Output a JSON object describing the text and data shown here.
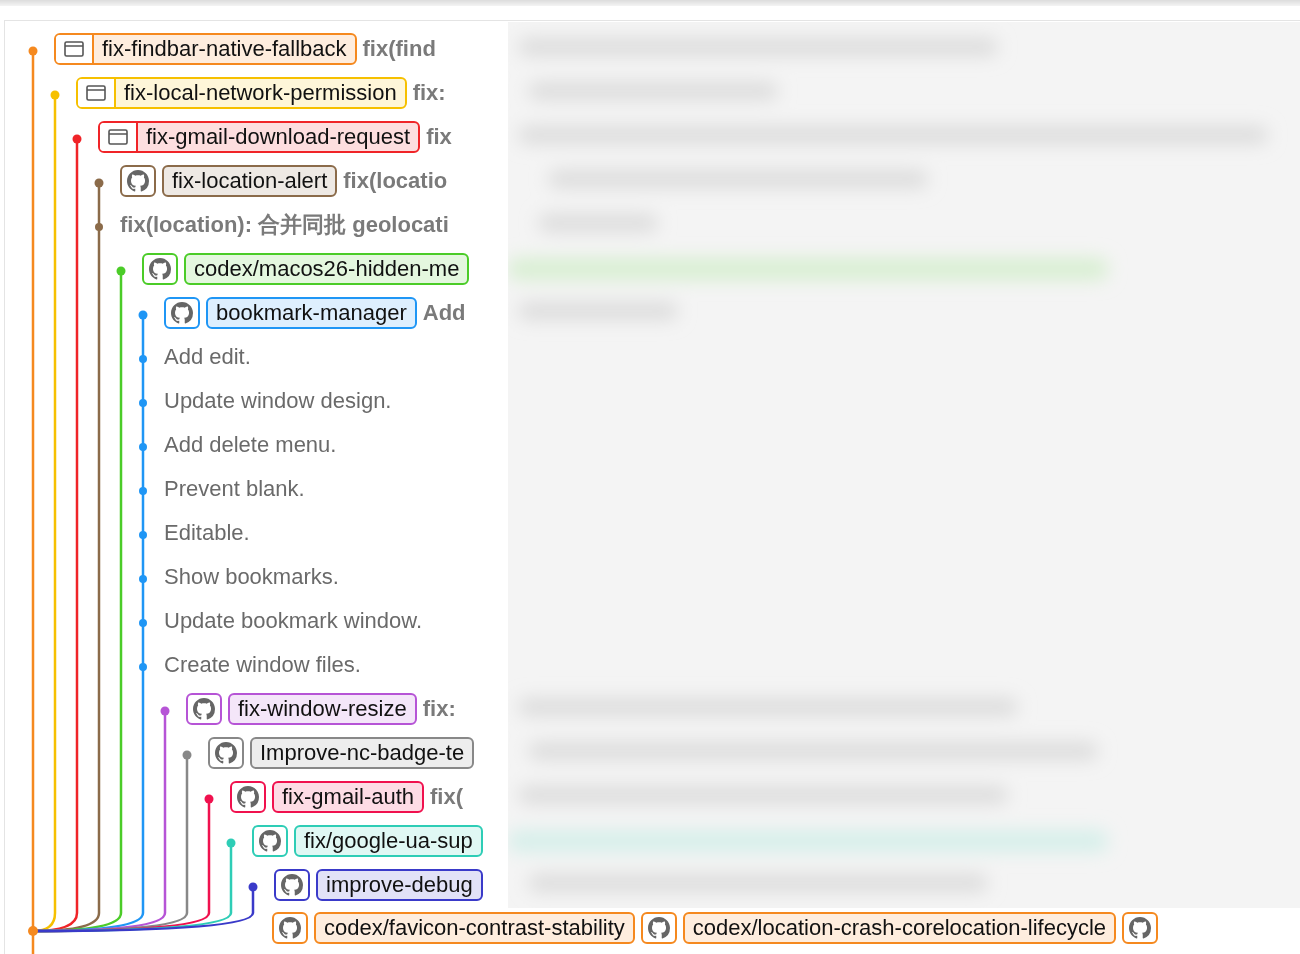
{
  "branches": [
    {
      "kind": "local",
      "name": "fix-findbar-native-fallback",
      "color": "#f5891f",
      "message": "fix(find"
    },
    {
      "kind": "local",
      "name": "fix-local-network-permission",
      "color": "#f6c000",
      "message": "fix:"
    },
    {
      "kind": "local",
      "name": "fix-gmail-download-request",
      "color": "#f02428",
      "message": "fix"
    },
    {
      "kind": "github",
      "name": "fix-location-alert",
      "color": "#8b6b4a",
      "message": "fix(locatio",
      "commits": [
        "fix(location): 合并同批 geolocati"
      ]
    },
    {
      "kind": "github",
      "name": "codex/macos26-hidden-me",
      "color": "#4bcc28"
    },
    {
      "kind": "github",
      "name": "bookmark-manager",
      "color": "#1f96f5",
      "message": "Add",
      "commits": [
        "Add edit.",
        "Update window design.",
        "Add delete menu.",
        "Prevent blank.",
        "Editable.",
        "Show bookmarks.",
        "Update bookmark window.",
        "Create window files."
      ]
    },
    {
      "kind": "github",
      "name": "fix-window-resize",
      "color": "#b654d6",
      "message": "fix:"
    },
    {
      "kind": "github",
      "name": "Improve-nc-badge-te",
      "color": "#888888"
    },
    {
      "kind": "github",
      "name": "fix-gmail-auth",
      "color": "#f0114e",
      "message": "fix("
    },
    {
      "kind": "github",
      "name": "fix/google-ua-sup",
      "color": "#2ecdb6"
    },
    {
      "kind": "github",
      "name": "improve-debug",
      "color": "#3a3ac9"
    }
  ],
  "base_refs": [
    {
      "kind": "github",
      "name": "codex/favicon-contrast-stability"
    },
    {
      "kind": "github",
      "name": "codex/location-crash-corelocation-lifecycle"
    },
    {
      "kind": "github"
    }
  ]
}
